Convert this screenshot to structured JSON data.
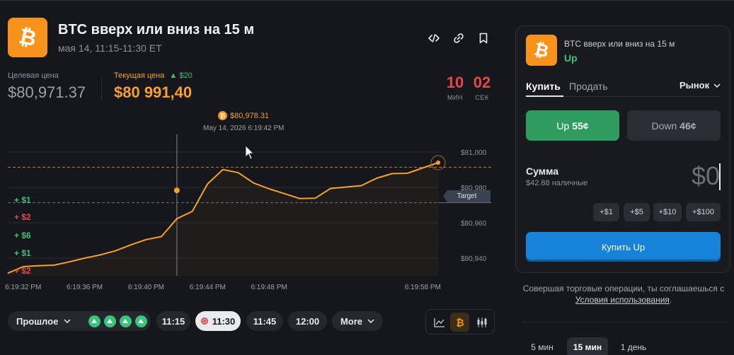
{
  "market": {
    "title": "BTC вверх или вниз на 15 м",
    "subtitle": "мая 14, 11:15-11:30 ET",
    "target_label": "Целевая цена",
    "target_price": "$80,971.37",
    "current_label": "Текущая цена",
    "current_delta": "$20",
    "current_price": "$80 991,40",
    "countdown": {
      "min": "10",
      "min_label": "МИН",
      "sec": "02",
      "sec_label": "СЕК"
    }
  },
  "icons": {
    "embed": "code-icon",
    "link": "link-icon",
    "bookmark": "bookmark-icon",
    "logo": "bitcoin-icon"
  },
  "colors": {
    "accent": "#f5a031",
    "up": "#3cc37a",
    "down": "#e24a4a",
    "buy": "#1683d8"
  },
  "chart_data": {
    "type": "line",
    "x": [
      "6:19:31",
      "6:19:32",
      "6:19:33",
      "6:19:34",
      "6:19:35",
      "6:19:36",
      "6:19:37",
      "6:19:38",
      "6:19:39",
      "6:19:40",
      "6:19:41",
      "6:19:42",
      "6:19:43",
      "6:19:44",
      "6:19:45",
      "6:19:46",
      "6:19:47",
      "6:19:48",
      "6:19:49",
      "6:19:50",
      "6:19:51",
      "6:19:52",
      "6:19:53",
      "6:19:54",
      "6:19:55",
      "6:19:56",
      "6:19:57",
      "6:19:58",
      "6:19:59"
    ],
    "values": [
      80931.5,
      80935.2,
      80935.7,
      80936.0,
      80937.9,
      80940.0,
      80941.8,
      80944.1,
      80947.5,
      80950.5,
      80952.2,
      80962.3,
      80966.4,
      80982.0,
      80990.1,
      80988.3,
      80982.5,
      80979.2,
      80976.5,
      80973.7,
      80973.9,
      80979.4,
      80980.2,
      80981.0,
      80985.2,
      80987.8,
      80988.0,
      80991.0,
      80994.0
    ],
    "xticks": [
      "6:19:32 PM",
      "6:19:36 PM",
      "6:19:40 PM",
      "6:19:44 PM",
      "6:19:48 PM",
      "6:19:58 PM"
    ],
    "yticks": [
      "$81,000",
      "$80,980",
      "$80,960",
      "$80,940"
    ],
    "ylim": [
      80930,
      81006
    ],
    "target": 80971.37,
    "current": 80991.4,
    "target_tag": "Target",
    "hover": {
      "price": "$80,978.31",
      "date": "May 14, 2026 6:19:42 PM",
      "x": "6:19:42",
      "y": 80978.31
    },
    "grid": true
  },
  "trades": [
    {
      "label": "+ $1",
      "color": "#3cc37a"
    },
    {
      "label": "+ $2",
      "color": "#e24a4a"
    },
    {
      "label": "+ $6",
      "color": "#3cc37a"
    },
    {
      "label": "+ $1",
      "color": "#3cc37a"
    },
    {
      "label": "+ $2",
      "color": "#e24a4a"
    }
  ],
  "timebar": {
    "past_label": "Прошлое",
    "times": [
      "11:15",
      "11:30",
      "11:45",
      "12:00"
    ],
    "active_time": "11:30",
    "more_label": "More"
  },
  "panel": {
    "title": "BTC вверх или вниз на 15 м",
    "outcome": "Up",
    "tab_buy": "Купить",
    "tab_sell": "Продать",
    "order_type": "Рынок",
    "up_label": "Up",
    "up_price": "55¢",
    "down_label": "Down",
    "down_price": "46¢",
    "amount_label": "Сумма",
    "cash": "$42.88 наличные",
    "amount": "$0",
    "quick": [
      "+$1",
      "+$5",
      "+$10",
      "+$100"
    ],
    "buy_button": "Купить Up",
    "disclaimer": "Совершая торговые операции, ты соглашаешься с",
    "terms": "Условия использования",
    "timeframes": [
      "5 мин",
      "15 мин",
      "1 день"
    ],
    "active_timeframe": "15 мин"
  }
}
